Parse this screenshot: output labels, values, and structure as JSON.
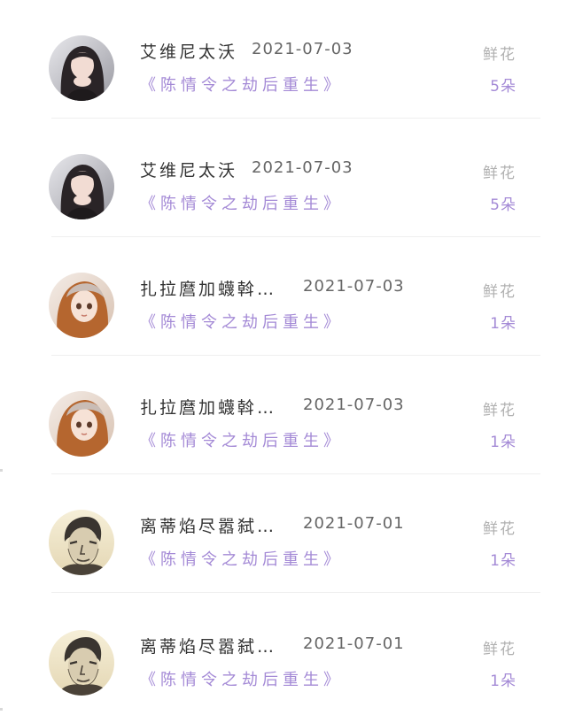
{
  "records": [
    {
      "avatar_icon": "woman-portrait-avatar-icon",
      "avatar_style": "girl",
      "user": "艾维尼太沃",
      "date": "2021-07-03",
      "drama": "《陈情令之劫后重生》",
      "gift_label": "鲜花",
      "gift_count": "5朵"
    },
    {
      "avatar_icon": "woman-portrait-avatar-icon",
      "avatar_style": "girl",
      "user": "艾维尼太沃",
      "date": "2021-07-03",
      "drama": "《陈情令之劫后重生》",
      "gift_label": "鲜花",
      "gift_count": "5朵"
    },
    {
      "avatar_icon": "doll-portrait-avatar-icon",
      "avatar_style": "doll",
      "user": "扎拉麿加蠛斡…",
      "date": "2021-07-03",
      "drama": "《陈情令之劫后重生》",
      "gift_label": "鲜花",
      "gift_count": "1朵"
    },
    {
      "avatar_icon": "doll-portrait-avatar-icon",
      "avatar_style": "doll",
      "user": "扎拉麿加蠛斡…",
      "date": "2021-07-03",
      "drama": "《陈情令之劫后重生》",
      "gift_label": "鲜花",
      "gift_count": "1朵"
    },
    {
      "avatar_icon": "sketch-man-avatar-icon",
      "avatar_style": "sketch",
      "user": "离蒂焰尽嚣弑…",
      "date": "2021-07-01",
      "drama": "《陈情令之劫后重生》",
      "gift_label": "鲜花",
      "gift_count": "1朵"
    },
    {
      "avatar_icon": "sketch-man-avatar-icon",
      "avatar_style": "sketch",
      "user": "离蒂焰尽嚣弑…",
      "date": "2021-07-01",
      "drama": "《陈情令之劫后重生》",
      "gift_label": "鲜花",
      "gift_count": "1朵"
    }
  ],
  "colors": {
    "accent": "#a48ad6",
    "name_text": "#333333",
    "date_text": "#666666",
    "gift_label_text": "#b0b0b0",
    "divider": "#efefef"
  }
}
